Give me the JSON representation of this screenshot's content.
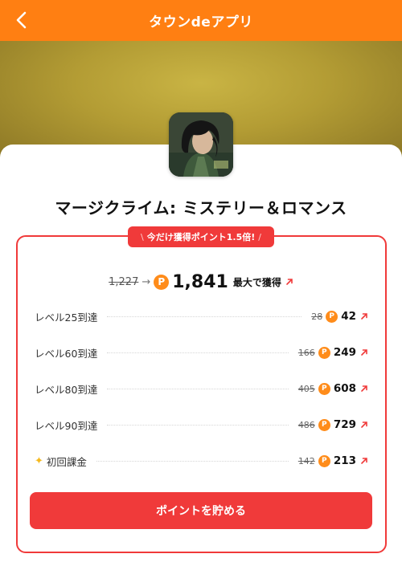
{
  "header": {
    "title": "タウンdeアプリ"
  },
  "app": {
    "title": "マージクライム: ミステリー＆ロマンス"
  },
  "promo": {
    "badge_text": "今だけ獲得ポイント1.5倍!"
  },
  "total": {
    "old": "1,227",
    "arrow": "→",
    "new": "1,841",
    "suffix": "最大で獲得"
  },
  "coin_symbol": "P",
  "tasks": [
    {
      "label": "レベル25到達",
      "old": "28",
      "new": "42"
    },
    {
      "label": "レベル60到達",
      "old": "166",
      "new": "249"
    },
    {
      "label": "レベル80到達",
      "old": "405",
      "new": "608"
    },
    {
      "label": "レベル90到達",
      "old": "486",
      "new": "729"
    },
    {
      "label": "初回課金",
      "old": "142",
      "new": "213"
    }
  ],
  "cta": {
    "label": "ポイントを貯める"
  },
  "colors": {
    "header": "#ff7f12",
    "accent_red": "#f03a3a",
    "coin": "#ff8c1a",
    "sparkle": "#f5b91e"
  },
  "icons": {
    "back": "chevron-left-icon",
    "external": "external-arrow-icon",
    "coin": "point-coin-icon",
    "sparkle": "sparkle-icon"
  }
}
